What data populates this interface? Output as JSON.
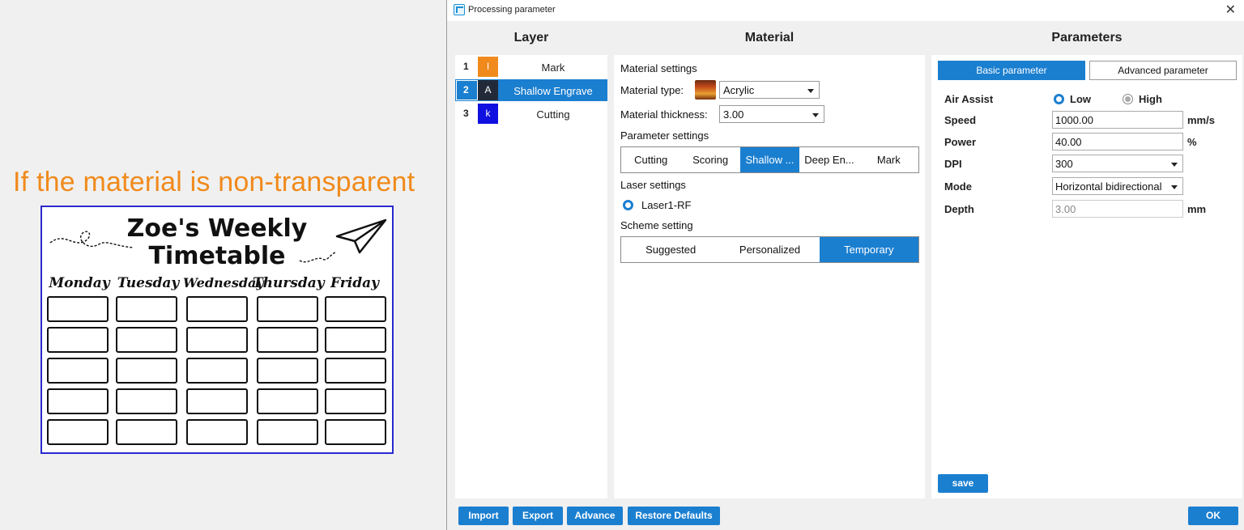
{
  "caption": "If the material is non-transparent",
  "timetable": {
    "title_line1": "Zoe's Weekly",
    "title_line2": "Timetable",
    "days": [
      "Monday",
      "Tuesday",
      "Wednesday",
      "Thursday",
      "Friday"
    ]
  },
  "dialog": {
    "title": "Processing parameter",
    "headers": {
      "layer": "Layer",
      "material": "Material",
      "parameters": "Parameters"
    },
    "layers": [
      {
        "num": "1",
        "glyph": "I",
        "color": "#f08a1c",
        "name": "Mark"
      },
      {
        "num": "2",
        "glyph": "A",
        "color": "#222a3a",
        "name": "Shallow Engrave"
      },
      {
        "num": "3",
        "glyph": "k",
        "color": "#1010e0",
        "name": "Cutting"
      }
    ],
    "material": {
      "settings_label": "Material settings",
      "type_label": "Material type:",
      "type_value": "Acrylic",
      "thickness_label": "Material thickness:",
      "thickness_value": "3.00",
      "parameter_settings_label": "Parameter settings",
      "parameter_tabs": [
        "Cutting",
        "Scoring",
        "Shallow ...",
        "Deep En...",
        "Mark"
      ],
      "laser_settings_label": "Laser settings",
      "laser_option": "Laser1-RF",
      "scheme_label": "Scheme setting",
      "scheme_tabs": [
        "Suggested",
        "Personalized",
        "Temporary"
      ]
    },
    "parameters": {
      "tab_basic": "Basic parameter",
      "tab_advanced": "Advanced parameter",
      "air_assist_label": "Air Assist",
      "air_low": "Low",
      "air_high": "High",
      "speed_label": "Speed",
      "speed_value": "1000.00",
      "speed_unit": "mm/s",
      "power_label": "Power",
      "power_value": "40.00",
      "power_unit": "%",
      "dpi_label": "DPI",
      "dpi_value": "300",
      "mode_label": "Mode",
      "mode_value": "Horizontal bidirectional",
      "depth_label": "Depth",
      "depth_value": "3.00",
      "depth_unit": "mm",
      "save": "save"
    },
    "footer": {
      "import": "Import",
      "export": "Export",
      "advance": "Advance",
      "restore": "Restore Defaults",
      "ok": "OK"
    },
    "accent_color": "#1b7fd0"
  }
}
